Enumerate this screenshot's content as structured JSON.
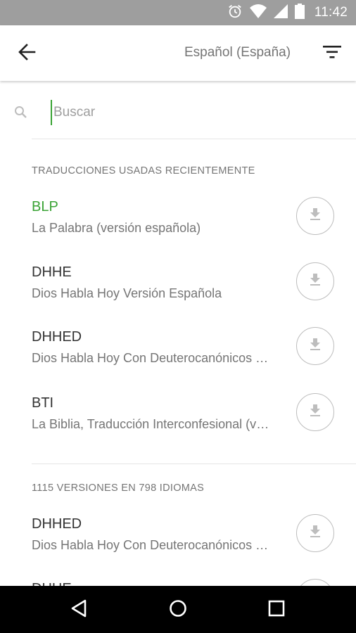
{
  "status_bar": {
    "time": "11:42"
  },
  "app_bar": {
    "title": "Español (España)"
  },
  "search": {
    "placeholder": "Buscar",
    "value": ""
  },
  "recent": {
    "header": "TRADUCCIONES USADAS RECIENTEMENTE",
    "items": [
      {
        "abbr": "BLP",
        "name": "La Palabra (versión española)",
        "selected": true
      },
      {
        "abbr": "DHHE",
        "name": "Dios Habla Hoy Versión Española"
      },
      {
        "abbr": "DHHED",
        "name": "Dios Habla Hoy Con Deuterocanónicos Versión Española"
      },
      {
        "abbr": "BTI",
        "name": "La Biblia, Traducción Interconfesional (versión española)"
      }
    ]
  },
  "all_versions": {
    "header": "1115 VERSIONES EN 798 IDIOMAS",
    "items": [
      {
        "abbr": "DHHED",
        "name": "Dios Habla Hoy Con Deuterocanónicos Versión Española"
      },
      {
        "abbr": "DHHE",
        "name": ""
      }
    ]
  },
  "colors": {
    "accent": "#3aa335",
    "status_bar": "#9e9e9e",
    "nav_bar": "#000000"
  },
  "icons": [
    "alarm-icon",
    "wifi-icon",
    "signal-icon",
    "battery-icon",
    "back-arrow-icon",
    "filter-icon",
    "search-icon",
    "download-icon",
    "nav-back-icon",
    "nav-home-icon",
    "nav-recents-icon"
  ]
}
